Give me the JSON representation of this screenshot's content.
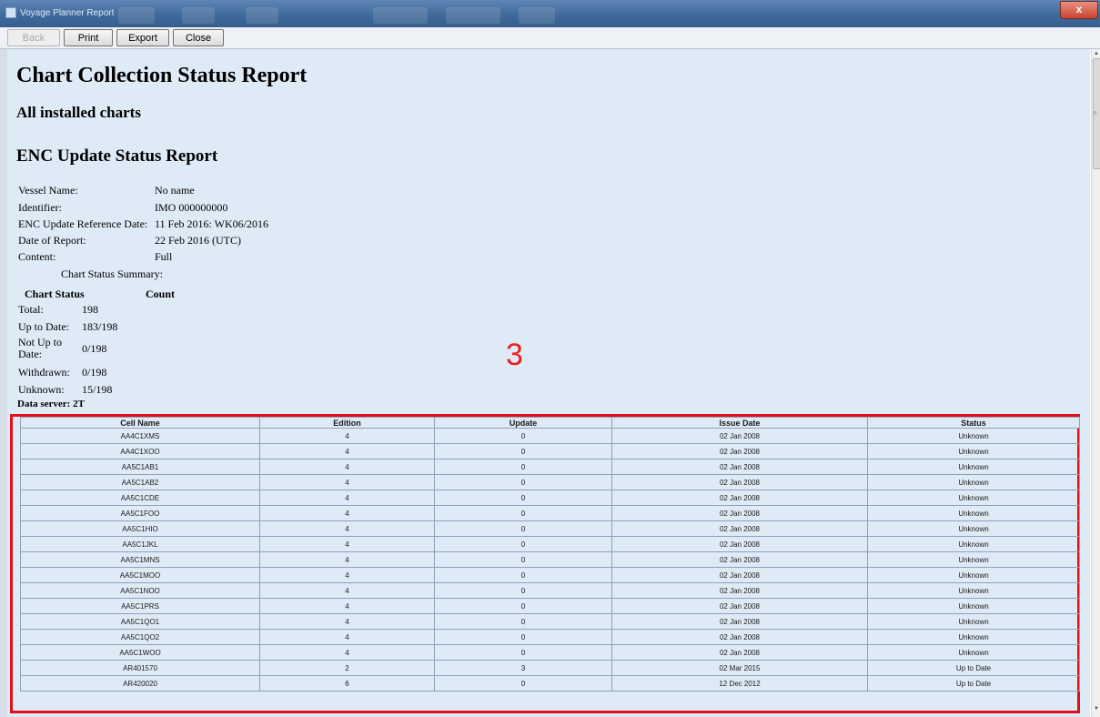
{
  "window": {
    "title": "Voyage Planner Report",
    "close_glyph": "x"
  },
  "toolbar": {
    "back": "Back",
    "print": "Print",
    "export": "Export",
    "close": "Close"
  },
  "report": {
    "title": "Chart Collection Status Report",
    "subtitle": "All installed charts",
    "section": "ENC Update Status Report",
    "fields": [
      {
        "label": "Vessel Name:",
        "value": "No name"
      },
      {
        "label": "Identifier:",
        "value": "IMO 000000000"
      },
      {
        "label": "ENC Update Reference Date:",
        "value": "11 Feb 2016: WK06/2016"
      },
      {
        "label": "Date of Report:",
        "value": "22 Feb 2016 (UTC)"
      },
      {
        "label": "Content:",
        "value": "Full"
      }
    ],
    "summary_caption": "Chart Status Summary:",
    "summary_headers": {
      "status": "Chart Status",
      "count": "Count"
    },
    "summary": [
      {
        "label": "Total:",
        "value": "198"
      },
      {
        "label": "Up to Date:",
        "value": "183/198"
      },
      {
        "label": "Not Up to Date:",
        "value": "0/198"
      },
      {
        "label": "Withdrawn:",
        "value": "0/198"
      },
      {
        "label": "Unknown:",
        "value": "15/198"
      }
    ],
    "data_server": "Data server: 2T",
    "annotation_number": "3"
  },
  "table": {
    "headers": [
      "Cell Name",
      "Edition",
      "Update",
      "Issue Date",
      "Status"
    ],
    "rows": [
      [
        "AA4C1XMS",
        "4",
        "0",
        "02 Jan 2008",
        "Unknown"
      ],
      [
        "AA4C1XOO",
        "4",
        "0",
        "02 Jan 2008",
        "Unknown"
      ],
      [
        "AA5C1AB1",
        "4",
        "0",
        "02 Jan 2008",
        "Unknown"
      ],
      [
        "AA5C1AB2",
        "4",
        "0",
        "02 Jan 2008",
        "Unknown"
      ],
      [
        "AA5C1CDE",
        "4",
        "0",
        "02 Jan 2008",
        "Unknown"
      ],
      [
        "AA5C1FOO",
        "4",
        "0",
        "02 Jan 2008",
        "Unknown"
      ],
      [
        "AA5C1HIO",
        "4",
        "0",
        "02 Jan 2008",
        "Unknown"
      ],
      [
        "AA5C1JKL",
        "4",
        "0",
        "02 Jan 2008",
        "Unknown"
      ],
      [
        "AA5C1MNS",
        "4",
        "0",
        "02 Jan 2008",
        "Unknown"
      ],
      [
        "AA5C1MOO",
        "4",
        "0",
        "02 Jan 2008",
        "Unknown"
      ],
      [
        "AA5C1NOO",
        "4",
        "0",
        "02 Jan 2008",
        "Unknown"
      ],
      [
        "AA5C1PRS",
        "4",
        "0",
        "02 Jan 2008",
        "Unknown"
      ],
      [
        "AA5C1QO1",
        "4",
        "0",
        "02 Jan 2008",
        "Unknown"
      ],
      [
        "AA5C1QO2",
        "4",
        "0",
        "02 Jan 2008",
        "Unknown"
      ],
      [
        "AA5C1WOO",
        "4",
        "0",
        "02 Jan 2008",
        "Unknown"
      ],
      [
        "AR401570",
        "2",
        "3",
        "02 Mar 2015",
        "Up to Date"
      ],
      [
        "AR420020",
        "6",
        "0",
        "12 Dec 2012",
        "Up to Date"
      ]
    ]
  },
  "colors": {
    "highlight": "#e0101a",
    "annotation": "#ee1c1c",
    "report_bg": "#dfeaf7"
  }
}
